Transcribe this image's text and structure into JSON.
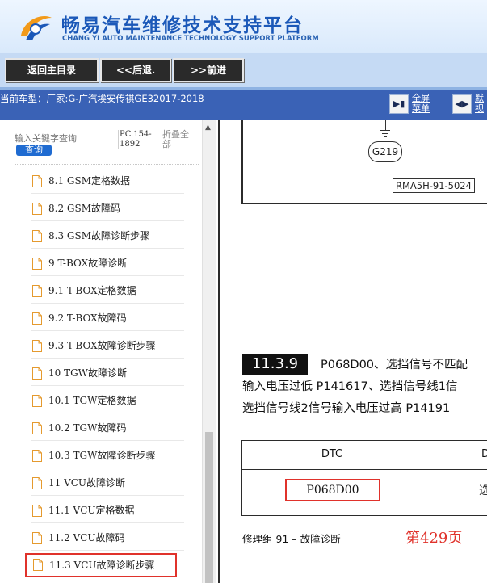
{
  "header": {
    "title_cn": "畅易汽车维修技术支持平台",
    "title_en": "CHANG YI AUTO MAINTENANCE TECHNOLOGY SUPPORT PLATFORM"
  },
  "toolbar": {
    "home_label": "返回主目录",
    "back_label": "<<后退.",
    "forward_label": ">>前进"
  },
  "vehicle_bar": {
    "text": "当前车型：厂家:G-广汽埃安传祺GE32017-2018",
    "fullscreen_line1": "全屏",
    "fullscreen_line2": "菜单",
    "default_line1": "默",
    "default_line2": "视"
  },
  "sidebar": {
    "search_placeholder": "输入关键字查询",
    "search_button": "查询",
    "pc_range": "PC.154-1892",
    "collapse_all": "折叠全部",
    "items": [
      {
        "label": "8.1 GSM定格数据"
      },
      {
        "label": "8.2 GSM故障码"
      },
      {
        "label": "8.3 GSM故障诊断步骤"
      },
      {
        "label": "9 T-BOX故障诊断"
      },
      {
        "label": "9.1 T-BOX定格数据"
      },
      {
        "label": "9.2 T-BOX故障码"
      },
      {
        "label": "9.3 T-BOX故障诊断步骤"
      },
      {
        "label": "10 TGW故障诊断"
      },
      {
        "label": "10.1 TGW定格数据"
      },
      {
        "label": "10.2 TGW故障码"
      },
      {
        "label": "10.3 TGW故障诊断步骤"
      },
      {
        "label": "11 VCU故障诊断"
      },
      {
        "label": "11.1 VCU定格数据"
      },
      {
        "label": "11.2 VCU故障码"
      },
      {
        "label": "11.3 VCU故障诊断步骤"
      }
    ],
    "selected_index": 14
  },
  "content": {
    "diagram": {
      "ground_label": "G219",
      "figure_code": "RMA5H-91-5024"
    },
    "section_number": "11.3.9",
    "section_line1": "P068D00、选挡信号不匹配",
    "section_line2": "输入电压过低 P141617、选挡信号线1信",
    "section_line3": "选挡信号线2信号输入电压过高 P14191",
    "table": {
      "header_dtc": "DTC",
      "header_desc": "D",
      "code": "P068D00",
      "desc": "选挡"
    },
    "footer_text": "修理组 91 – 故障诊断",
    "page_label": "第429页"
  },
  "colors": {
    "brand_blue": "#1b58b8",
    "info_bar": "#3a62b6",
    "highlight_red": "#e0322b"
  }
}
